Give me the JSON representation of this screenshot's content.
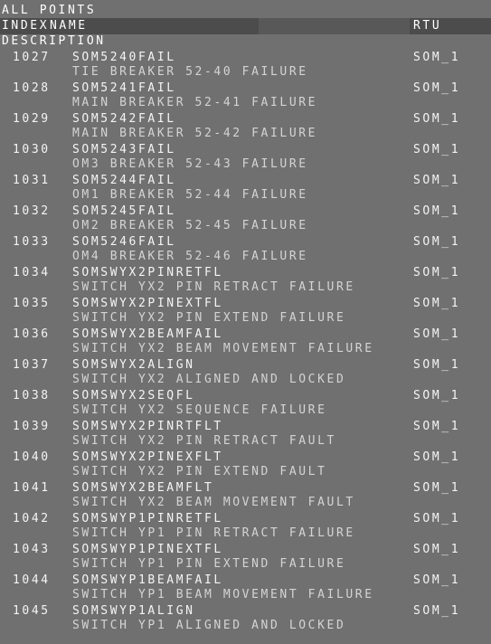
{
  "title": "ALL POINTS",
  "columns": {
    "index": "INDEX",
    "name": "NAME",
    "rtu": "RTU",
    "description": "DESCRIPTION"
  },
  "points": [
    {
      "index": "1027",
      "name": "SOM5240FAIL",
      "rtu": "SOM_1",
      "description": "TIE BREAKER 52-40 FAILURE"
    },
    {
      "index": "1028",
      "name": "SOM5241FAIL",
      "rtu": "SOM_1",
      "description": "MAIN BREAKER 52-41 FAILURE"
    },
    {
      "index": "1029",
      "name": "SOM5242FAIL",
      "rtu": "SOM_1",
      "description": "MAIN BREAKER 52-42 FAILURE"
    },
    {
      "index": "1030",
      "name": "SOM5243FAIL",
      "rtu": "SOM_1",
      "description": "OM3 BREAKER 52-43 FAILURE"
    },
    {
      "index": "1031",
      "name": "SOM5244FAIL",
      "rtu": "SOM_1",
      "description": "OM1 BREAKER 52-44 FAILURE"
    },
    {
      "index": "1032",
      "name": "SOM5245FAIL",
      "rtu": "SOM_1",
      "description": "OM2 BREAKER 52-45 FAILURE"
    },
    {
      "index": "1033",
      "name": "SOM5246FAIL",
      "rtu": "SOM_1",
      "description": "OM4 BREAKER 52-46 FAILURE"
    },
    {
      "index": "1034",
      "name": "SOMSWYX2PINRETFL",
      "rtu": "SOM_1",
      "description": "SWITCH YX2 PIN RETRACT FAILURE"
    },
    {
      "index": "1035",
      "name": "SOMSWYX2PINEXTFL",
      "rtu": "SOM_1",
      "description": "SWITCH YX2 PIN EXTEND FAILURE"
    },
    {
      "index": "1036",
      "name": "SOMSWYX2BEAMFAIL",
      "rtu": "SOM_1",
      "description": "SWITCH YX2 BEAM MOVEMENT FAILURE"
    },
    {
      "index": "1037",
      "name": "SOMSWYX2ALIGN",
      "rtu": "SOM_1",
      "description": "SWITCH YX2 ALIGNED AND LOCKED"
    },
    {
      "index": "1038",
      "name": "SOMSWYX2SEQFL",
      "rtu": "SOM_1",
      "description": "SWITCH YX2 SEQUENCE FAILURE"
    },
    {
      "index": "1039",
      "name": "SOMSWYX2PINRTFLT",
      "rtu": "SOM_1",
      "description": "SWITCH YX2 PIN RETRACT FAULT"
    },
    {
      "index": "1040",
      "name": "SOMSWYX2PINEXFLT",
      "rtu": "SOM_1",
      "description": "SWITCH YX2 PIN EXTEND FAULT"
    },
    {
      "index": "1041",
      "name": "SOMSWYX2BEAMFLT",
      "rtu": "SOM_1",
      "description": "SWITCH YX2 BEAM MOVEMENT FAULT"
    },
    {
      "index": "1042",
      "name": "SOMSWYP1PINRETFL",
      "rtu": "SOM_1",
      "description": "SWITCH YP1 PIN RETRACT FAILURE"
    },
    {
      "index": "1043",
      "name": "SOMSWYP1PINEXTFL",
      "rtu": "SOM_1",
      "description": "SWITCH YP1 PIN EXTEND FAILURE"
    },
    {
      "index": "1044",
      "name": "SOMSWYP1BEAMFAIL",
      "rtu": "SOM_1",
      "description": "SWITCH YP1 BEAM MOVEMENT FAILURE"
    },
    {
      "index": "1045",
      "name": "SOMSWYP1ALIGN",
      "rtu": "SOM_1",
      "description": "SWITCH YP1 ALIGNED AND LOCKED"
    }
  ],
  "colors": {
    "background": "#707070",
    "header_band": "#4c4c4c",
    "text": "#ffffff",
    "description_text": "#d4d4d4"
  }
}
